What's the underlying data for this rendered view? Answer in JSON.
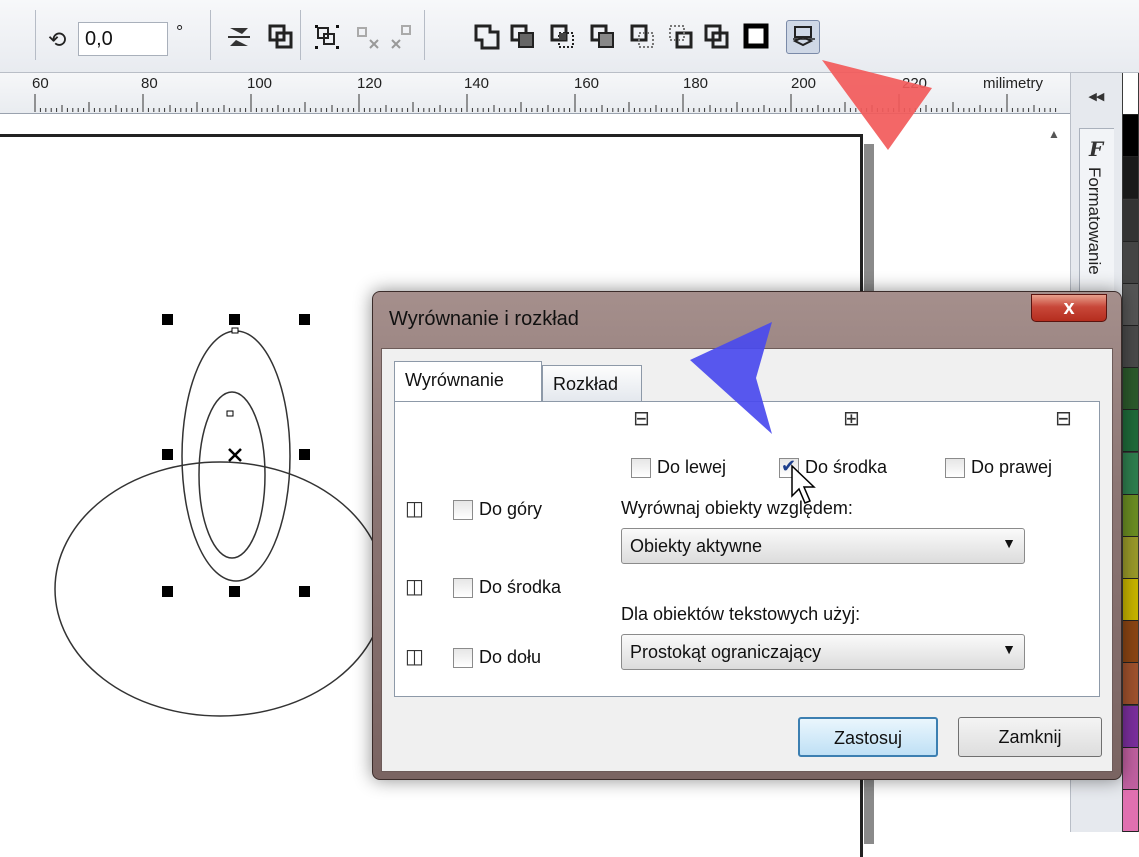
{
  "toolbar": {
    "rotation_value": "0,0",
    "degree_symbol": "°",
    "rotation_icon": "rotate-icon",
    "icons": [
      "mirror-icon",
      "combine-icon",
      "group-icon",
      "ungroup-icon",
      "ungroup-all-icon",
      "weld-icon",
      "trim-icon",
      "intersect-icon",
      "simplify-icon",
      "front-minus-back-icon",
      "back-minus-front-icon",
      "create-boundary-icon",
      "convert-outline-icon",
      "align-distribute-icon"
    ]
  },
  "ruler": {
    "numbers": [
      "60",
      "80",
      "100",
      "120",
      "140",
      "160",
      "180",
      "200",
      "220"
    ],
    "unit": "milimetry"
  },
  "docker": {
    "collapse": "◂◂",
    "f_icon": "F",
    "label": "Formatowanie"
  },
  "dialog": {
    "title": "Wyrównanie i rozkład",
    "close": "x",
    "tabs": [
      "Wyrównanie",
      "Rozkład"
    ],
    "horizontal": {
      "left": "Do lewej",
      "center": "Do środka",
      "right": "Do prawej"
    },
    "vertical": {
      "top": "Do góry",
      "center": "Do środka",
      "bottom": "Do dołu"
    },
    "align_relative_label": "Wyrównaj obiekty względem:",
    "align_relative_value": "Obiekty aktywne",
    "text_objects_label": "Dla obiektów tekstowych użyj:",
    "text_objects_value": "Prostokąt ograniczający",
    "apply_button": "Zastosuj",
    "close_button": "Zamknij"
  },
  "colors": {
    "red_arrow": "#f25a5a",
    "blue_arrow": "#4a4aee",
    "dialog_frame": "#8c7674",
    "close_button": "#c8483a"
  },
  "palette": [
    "#ffffff",
    "#000000",
    "#1a1a1a",
    "#333333",
    "#444444",
    "#555555",
    "#4a4a4a",
    "#2c5a2c",
    "#1f6b3a",
    "#2f7f4f",
    "#6b8e23",
    "#9a9a2a",
    "#c8b400",
    "#8b4513",
    "#a0522d",
    "#7b2f9e",
    "#c060a0",
    "#e070b0"
  ]
}
